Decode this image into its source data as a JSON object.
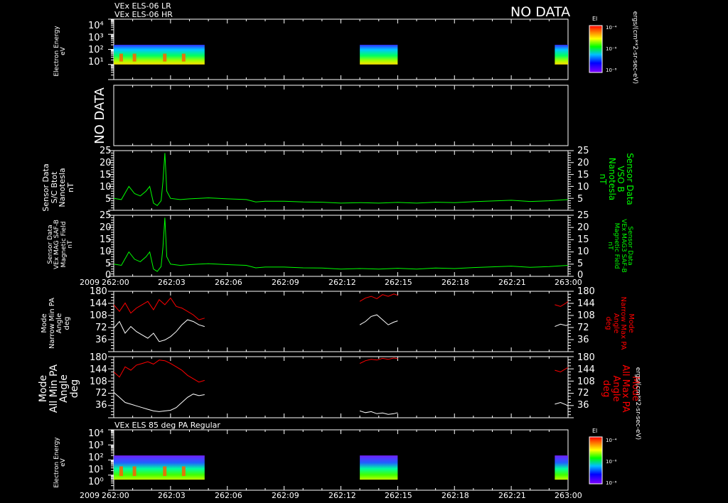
{
  "header": {
    "line1": "VEx ELS-06 LR",
    "line2": "VEx ELS-06 HR",
    "no_data": "NO DATA"
  },
  "colors": {
    "background": "#000000",
    "axes": "#ffffff",
    "green": "#00ff00",
    "red": "#ff0000",
    "white_trace": "#ffffff"
  },
  "panels": {
    "spec_top": {
      "ylabel": "Electron Energy\neV",
      "ticks": [
        "10⁴",
        "10³",
        "10²",
        "10¹"
      ],
      "colorbar_title": "El",
      "colorbar_ticks": [
        "10⁻⁴",
        "10⁻⁶",
        "10⁻⁸"
      ],
      "colorbar_units": "ergs/(cm**2-sr-sec-eV)"
    },
    "nodata": {
      "label": "NO DATA"
    },
    "b1": {
      "ylabel_left": "Sensor Data\nS/C Btot\nNanotesla\nnT",
      "ylabel_right": "Sensor Data\nVSO B\nNanotesla\nnT",
      "ticks": [
        "25",
        "20",
        "15",
        "10",
        "5"
      ]
    },
    "b2": {
      "ylabel_left": "Sensor Data\nVEx MAG SAF-B\nMagnetic Field\nnT",
      "ylabel_right": "Sensor Data\nVEx MAG3 SAF-B\nMagnetic Field\nnT",
      "ticks": [
        "25",
        "20",
        "15",
        "10",
        "5",
        "0"
      ]
    },
    "pa1": {
      "ylabel_left": "Mode\nNarrow Min PA\nAngle\ndeg",
      "ylabel_right": "Mode\nNarrow Max PA\nAngle\ndeg",
      "ticks": [
        "180",
        "144",
        "108",
        "72",
        "36"
      ]
    },
    "pa2": {
      "ylabel_left": "Mode\nAll Min PA\nAngle\ndeg",
      "ylabel_right": "Mode\nAll Max PA\nAngle\ndeg",
      "ticks": [
        "180",
        "144",
        "108",
        "72",
        "36"
      ]
    },
    "spec_bottom": {
      "title": "VEx ELS 85 deg PA Regular",
      "ylabel": "Electron Energy\neV",
      "ticks": [
        "10⁴",
        "10³",
        "10²",
        "10¹",
        "10⁰"
      ],
      "colorbar_title": "El",
      "colorbar_ticks": [
        "10⁻⁴",
        "10⁻⁶",
        "10⁻⁸"
      ],
      "colorbar_units": "ergs/(cm**2-sr-sec-eV)"
    }
  },
  "time_axis": {
    "year": "2009",
    "ticks": [
      "262:00",
      "262:03",
      "262:06",
      "262:09",
      "262:12",
      "262:15",
      "262:18",
      "262:21",
      "263:00"
    ]
  },
  "chart_data": [
    {
      "type": "heatmap",
      "title": "VEx ELS-06 LR / VEx ELS-06 HR",
      "ylabel": "Electron Energy eV",
      "y_scale": "log",
      "ylim": [
        1,
        10000
      ],
      "data_blocks_time_minutes": [
        [
          0,
          4.8
        ],
        [
          13,
          15
        ],
        [
          23.3,
          24
        ]
      ],
      "energy_range_eV": [
        10,
        200
      ],
      "color_scale": "log",
      "color_range": [
        1e-08,
        0.0001
      ]
    },
    {
      "type": "line",
      "ylabel": "Sensor Data S/C Btot Nanotesla nT",
      "ylim": [
        0,
        25
      ],
      "x_minutes": [
        0,
        0.4,
        0.8,
        1.1,
        1.4,
        1.7,
        1.9,
        2.1,
        2.3,
        2.5,
        2.6,
        2.7,
        2.8,
        3.0,
        3.5,
        4.0,
        4.5,
        5.0,
        6.0,
        7.0,
        7.5,
        8.0,
        9.0,
        10.0,
        11.0,
        12.0,
        13.0,
        14.0,
        15.0,
        16.0,
        17.0,
        18.0,
        19.0,
        20.0,
        21.0,
        22.0,
        23.0,
        24.0
      ],
      "values": [
        5,
        4.5,
        10,
        7,
        6,
        8,
        10,
        3,
        2,
        4,
        12,
        24,
        8,
        5,
        4.5,
        4.8,
        5,
        5.2,
        4.8,
        4.5,
        3.5,
        3.8,
        3.8,
        3.5,
        3.4,
        3.0,
        3.2,
        3.0,
        3.3,
        3.0,
        3.4,
        3.2,
        3.6,
        3.9,
        4.2,
        3.7,
        4.0,
        4.5
      ]
    },
    {
      "type": "line",
      "ylabel": "Sensor Data VEx MAG SAF-B Magnetic Field nT",
      "ylim": [
        0,
        25
      ],
      "x_minutes": [
        0,
        0.4,
        0.8,
        1.1,
        1.4,
        1.7,
        1.9,
        2.1,
        2.3,
        2.5,
        2.6,
        2.7,
        2.8,
        3.0,
        3.5,
        4.0,
        4.5,
        5.0,
        6.0,
        7.0,
        7.5,
        8.0,
        9.0,
        10.0,
        11.0,
        12.0,
        13.0,
        14.0,
        15.0,
        16.0,
        17.0,
        18.0,
        19.0,
        20.0,
        21.0,
        22.0,
        23.0,
        24.0
      ],
      "values": [
        5,
        4.5,
        10,
        7,
        6,
        8,
        10,
        3,
        2,
        4,
        12,
        24,
        8,
        5,
        4.5,
        4.8,
        5,
        5.2,
        4.8,
        4.5,
        3.5,
        3.8,
        3.8,
        3.5,
        3.4,
        3.0,
        3.2,
        3.0,
        3.3,
        3.0,
        3.4,
        3.2,
        3.6,
        3.9,
        4.2,
        3.7,
        4.0,
        4.5
      ]
    },
    {
      "type": "line",
      "ylabel": "Mode Narrow Min PA Angle deg / Mode Narrow Max PA Angle deg",
      "ylim": [
        0,
        180
      ],
      "series": [
        {
          "name": "Narrow Max PA",
          "segments": [
            {
              "x": [
                0,
                0.3,
                0.6,
                0.9,
                1.2,
                1.5,
                1.8,
                2.1,
                2.4,
                2.7,
                3.0,
                3.3,
                3.6,
                3.9,
                4.2,
                4.5,
                4.8
              ],
              "y": [
                140,
                120,
                145,
                115,
                130,
                140,
                150,
                125,
                155,
                140,
                160,
                135,
                130,
                120,
                110,
                95,
                100
              ]
            },
            {
              "x": [
                13.0,
                13.3,
                13.6,
                13.9,
                14.2,
                14.5,
                14.8,
                15.0
              ],
              "y": [
                150,
                160,
                165,
                158,
                170,
                165,
                172,
                168
              ]
            },
            {
              "x": [
                23.3,
                23.6,
                23.9,
                24.0
              ],
              "y": [
                140,
                135,
                145,
                150
              ]
            }
          ]
        },
        {
          "name": "Narrow Min PA",
          "segments": [
            {
              "x": [
                0,
                0.3,
                0.6,
                0.9,
                1.2,
                1.5,
                1.8,
                2.1,
                2.4,
                2.7,
                3.0,
                3.3,
                3.6,
                3.9,
                4.2,
                4.5,
                4.8
              ],
              "y": [
                70,
                90,
                55,
                75,
                60,
                50,
                40,
                55,
                30,
                35,
                45,
                60,
                80,
                95,
                90,
                80,
                75
              ]
            },
            {
              "x": [
                13.0,
                13.3,
                13.6,
                13.9,
                14.2,
                14.5,
                14.8,
                15.0
              ],
              "y": [
                80,
                90,
                105,
                110,
                95,
                80,
                88,
                92
              ]
            },
            {
              "x": [
                23.3,
                23.6,
                23.9,
                24.0
              ],
              "y": [
                75,
                82,
                78,
                80
              ]
            }
          ]
        }
      ]
    },
    {
      "type": "line",
      "ylabel": "Mode All Min PA Angle deg / Mode All Max PA Angle deg",
      "ylim": [
        0,
        180
      ],
      "series": [
        {
          "name": "All Max PA",
          "segments": [
            {
              "x": [
                0,
                0.3,
                0.6,
                0.9,
                1.2,
                1.5,
                1.8,
                2.1,
                2.4,
                2.7,
                3.0,
                3.3,
                3.6,
                3.9,
                4.2,
                4.5,
                4.8
              ],
              "y": [
                135,
                120,
                150,
                140,
                155,
                160,
                165,
                158,
                170,
                168,
                160,
                150,
                140,
                125,
                115,
                105,
                110
              ]
            },
            {
              "x": [
                13.0,
                13.3,
                13.6,
                13.9,
                14.2,
                14.5,
                14.8,
                15.0
              ],
              "y": [
                160,
                168,
                172,
                170,
                175,
                172,
                176,
                174
              ]
            },
            {
              "x": [
                23.3,
                23.6,
                23.9,
                24.0
              ],
              "y": [
                140,
                135,
                145,
                148
              ]
            }
          ]
        },
        {
          "name": "All Min PA",
          "segments": [
            {
              "x": [
                0,
                0.3,
                0.6,
                0.9,
                1.2,
                1.5,
                1.8,
                2.1,
                2.4,
                2.7,
                3.0,
                3.3,
                3.6,
                3.9,
                4.2,
                4.5,
                4.8
              ],
              "y": [
                75,
                60,
                45,
                40,
                35,
                30,
                25,
                20,
                18,
                20,
                22,
                30,
                45,
                60,
                70,
                65,
                68
              ]
            },
            {
              "x": [
                13.0,
                13.3,
                13.6,
                13.9,
                14.2,
                14.5,
                14.8,
                15.0
              ],
              "y": [
                20,
                15,
                18,
                12,
                14,
                10,
                12,
                15
              ]
            },
            {
              "x": [
                23.3,
                23.6,
                23.9,
                24.0
              ],
              "y": [
                40,
                45,
                38,
                35
              ]
            }
          ]
        }
      ]
    },
    {
      "type": "heatmap",
      "title": "VEx ELS 85 deg PA Regular",
      "ylabel": "Electron Energy eV",
      "y_scale": "log",
      "ylim": [
        1,
        10000
      ],
      "data_blocks_time_minutes": [
        [
          0,
          4.8
        ],
        [
          13,
          15
        ],
        [
          23.3,
          24
        ]
      ],
      "energy_range_eV": [
        5,
        200
      ],
      "color_scale": "log",
      "color_range": [
        1e-08,
        0.0001
      ]
    }
  ]
}
